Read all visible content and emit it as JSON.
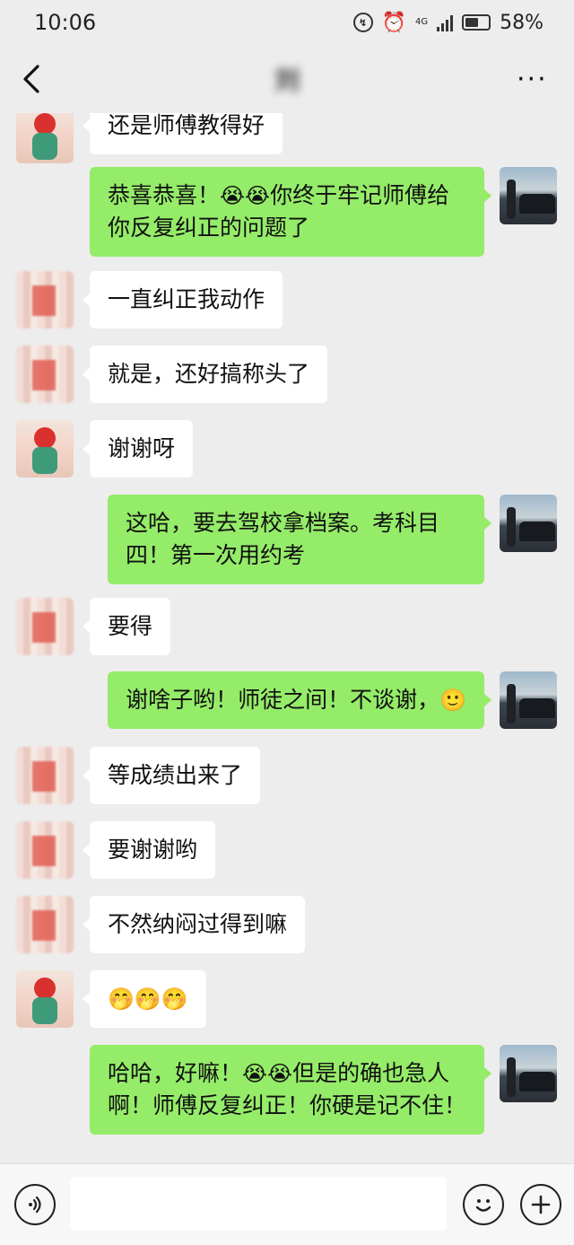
{
  "status_bar": {
    "time": "10:06",
    "network": "4G",
    "battery": "58%"
  },
  "header": {
    "title": "刘",
    "more_label": "···"
  },
  "messages": [
    {
      "side": "in",
      "avatar": "girl",
      "text": "还是师傅教得好"
    },
    {
      "side": "out",
      "avatar": "car",
      "text_a": "恭喜恭喜！",
      "emoji": "😭😭",
      "text_b": "你终于牢记师傅给你反复纠正的问题了"
    },
    {
      "side": "in",
      "avatar": "blur",
      "text": "一直纠正我动作"
    },
    {
      "side": "in",
      "avatar": "blur",
      "text": "就是，还好搞称头了"
    },
    {
      "side": "in",
      "avatar": "girl",
      "text": "谢谢呀"
    },
    {
      "side": "out",
      "avatar": "car",
      "text": "这哈，要去驾校拿档案。考科目四！第一次用约考"
    },
    {
      "side": "in",
      "avatar": "blur",
      "text": "要得"
    },
    {
      "side": "out",
      "avatar": "car",
      "text": "谢啥子哟！师徒之间！不谈谢，",
      "emoji": "🙂"
    },
    {
      "side": "in",
      "avatar": "blur",
      "text": "等成绩出来了"
    },
    {
      "side": "in",
      "avatar": "blur",
      "text": "要谢谢哟"
    },
    {
      "side": "in",
      "avatar": "blur",
      "text": "不然纳闷过得到嘛"
    },
    {
      "side": "in",
      "avatar": "girl",
      "emoji": "🤭🤭🤭"
    },
    {
      "side": "out",
      "avatar": "car",
      "text_a": "哈哈，好嘛！",
      "emoji": "😭😭",
      "text_b": "但是的确也急人啊！师傅反复纠正！你硬是记不住！"
    }
  ],
  "colors": {
    "background": "#ededed",
    "outgoing_bubble": "#95ec69",
    "incoming_bubble": "#ffffff"
  }
}
